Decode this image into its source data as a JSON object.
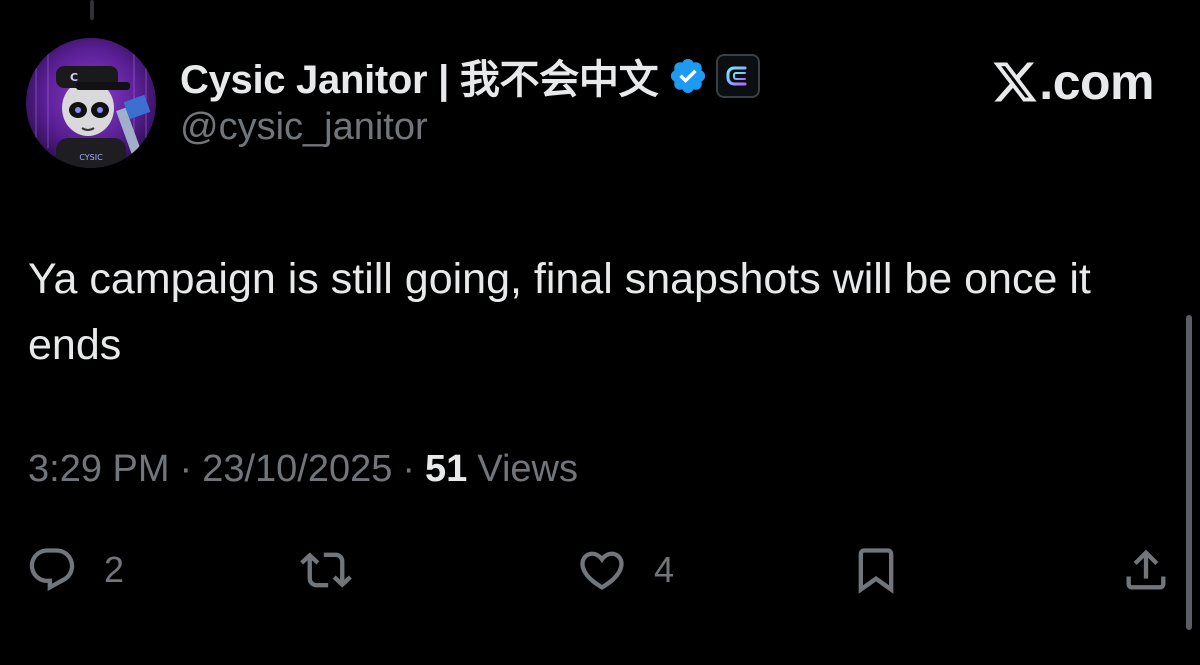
{
  "author": {
    "display_name": "Cysic Janitor | 我不会中文",
    "handle": "@cysic_janitor",
    "verified": true,
    "avatar_icon": "avatar-image",
    "affiliate_badge_icon": "cysic-logo-icon"
  },
  "brand": {
    "label": ".com",
    "logo_icon": "x-logo-icon"
  },
  "tweet": {
    "text": "Ya campaign is still going, final snapshots will be once it ends",
    "time": "3:29 PM",
    "separator": "·",
    "date": "23/10/2025",
    "views_count": "51",
    "views_label": "Views"
  },
  "actions": {
    "reply_count": "2",
    "like_count": "4"
  },
  "colors": {
    "background": "#000000",
    "primary_text": "#e7e9ea",
    "secondary_text": "#71767b",
    "verified_blue": "#1d9bf0",
    "avatar_purple": "#6a2ea8"
  }
}
